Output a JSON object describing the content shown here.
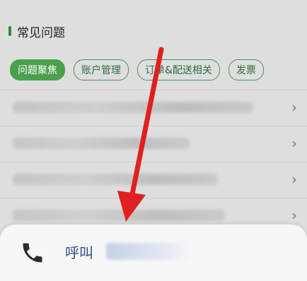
{
  "faq": {
    "title": "常见问题",
    "chips": [
      {
        "label": "问题聚焦",
        "active": true
      },
      {
        "label": "账户管理",
        "active": false
      },
      {
        "label": "订单&配送相关",
        "active": false
      },
      {
        "label": "发票",
        "active": false
      }
    ],
    "items": [
      {
        "text": "",
        "chevron": "›"
      },
      {
        "text": "",
        "chevron": "›"
      },
      {
        "text": "",
        "chevron": "›"
      },
      {
        "text": "",
        "chevron": "›"
      }
    ]
  },
  "call": {
    "label": "呼叫",
    "icon": "phone-icon"
  },
  "colors": {
    "accent_green": "#49a04d",
    "arrow_red": "#e02020",
    "call_text": "#2d4f86"
  }
}
